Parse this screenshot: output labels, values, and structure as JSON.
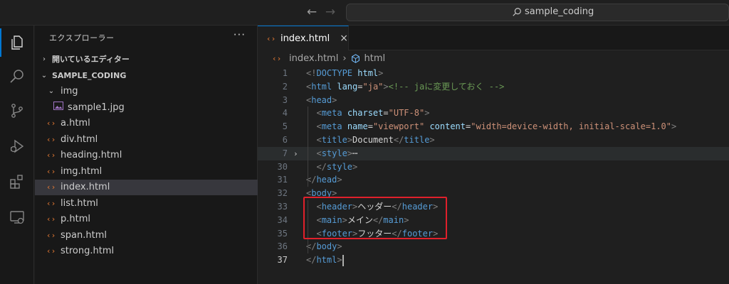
{
  "titlebar": {
    "search_text": "sample_coding",
    "back_icon": "arrow-left-icon",
    "forward_icon": "arrow-right-icon"
  },
  "activity_bar": [
    "explorer-icon",
    "search-icon",
    "source-control-icon",
    "run-debug-icon",
    "extensions-icon",
    "remote-explorer-icon"
  ],
  "sidebar": {
    "title": "エクスプローラー",
    "more": "···",
    "open_editors": "開いているエディター",
    "project": "SAMPLE_CODING",
    "folder": "img",
    "items": [
      {
        "label": "sample1.jpg",
        "type": "image"
      },
      {
        "label": "a.html",
        "type": "html"
      },
      {
        "label": "div.html",
        "type": "html"
      },
      {
        "label": "heading.html",
        "type": "html"
      },
      {
        "label": "img.html",
        "type": "html"
      },
      {
        "label": "index.html",
        "type": "html",
        "selected": true
      },
      {
        "label": "list.html",
        "type": "html"
      },
      {
        "label": "p.html",
        "type": "html"
      },
      {
        "label": "span.html",
        "type": "html"
      },
      {
        "label": "strong.html",
        "type": "html"
      }
    ]
  },
  "editor": {
    "tab_label": "index.html",
    "tab_close": "×",
    "tab_icon": "‹›",
    "breadcrumb": {
      "file": "index.html",
      "sep": "›",
      "node": "html"
    },
    "lines": [
      {
        "n": "1",
        "segments": [
          [
            "br",
            "<!"
          ],
          [
            "tag",
            "DOCTYPE "
          ],
          [
            "attr",
            "html"
          ],
          [
            "br",
            ">"
          ]
        ]
      },
      {
        "n": "2",
        "segments": [
          [
            "br",
            "<"
          ],
          [
            "tag",
            "html "
          ],
          [
            "attr",
            "lang"
          ],
          [
            "txt",
            "="
          ],
          [
            "str",
            "\"ja\""
          ],
          [
            "br",
            ">"
          ],
          [
            "com",
            "<!-- jaに変更しておく -->"
          ]
        ]
      },
      {
        "n": "3",
        "segments": [
          [
            "br",
            "<"
          ],
          [
            "tag",
            "head"
          ],
          [
            "br",
            ">"
          ]
        ]
      },
      {
        "n": "4",
        "segments": [
          [
            "txt",
            "  "
          ],
          [
            "br",
            "<"
          ],
          [
            "tag",
            "meta "
          ],
          [
            "attr",
            "charset"
          ],
          [
            "txt",
            "="
          ],
          [
            "str",
            "\"UTF-8\""
          ],
          [
            "br",
            ">"
          ]
        ]
      },
      {
        "n": "5",
        "segments": [
          [
            "txt",
            "  "
          ],
          [
            "br",
            "<"
          ],
          [
            "tag",
            "meta "
          ],
          [
            "attr",
            "name"
          ],
          [
            "txt",
            "="
          ],
          [
            "str",
            "\"viewport\" "
          ],
          [
            "attr",
            "content"
          ],
          [
            "txt",
            "="
          ],
          [
            "str",
            "\"width=device-width, initial-scale=1.0\""
          ],
          [
            "br",
            ">"
          ]
        ]
      },
      {
        "n": "6",
        "segments": [
          [
            "txt",
            "  "
          ],
          [
            "br",
            "<"
          ],
          [
            "tag",
            "title"
          ],
          [
            "br",
            ">"
          ],
          [
            "txt",
            "Document"
          ],
          [
            "br",
            "</"
          ],
          [
            "tag",
            "title"
          ],
          [
            "br",
            ">"
          ]
        ]
      },
      {
        "n": "7",
        "segments": [
          [
            "txt",
            "  "
          ],
          [
            "br",
            "<"
          ],
          [
            "tag",
            "style"
          ],
          [
            "br",
            ">"
          ],
          [
            "txt",
            "⋯"
          ]
        ]
      },
      {
        "n": "30",
        "segments": [
          [
            "txt",
            "  "
          ],
          [
            "br",
            "</"
          ],
          [
            "tag",
            "style"
          ],
          [
            "br",
            ">"
          ]
        ]
      },
      {
        "n": "31",
        "segments": [
          [
            "br",
            "</"
          ],
          [
            "tag",
            "head"
          ],
          [
            "br",
            ">"
          ]
        ]
      },
      {
        "n": "32",
        "segments": [
          [
            "br",
            "<"
          ],
          [
            "tag",
            "body"
          ],
          [
            "br",
            ">"
          ]
        ]
      },
      {
        "n": "33",
        "segments": [
          [
            "txt",
            "  "
          ],
          [
            "br",
            "<"
          ],
          [
            "tag",
            "header"
          ],
          [
            "br",
            ">"
          ],
          [
            "txt",
            "ヘッダー"
          ],
          [
            "br",
            "</"
          ],
          [
            "tag",
            "header"
          ],
          [
            "br",
            ">"
          ]
        ]
      },
      {
        "n": "34",
        "segments": [
          [
            "txt",
            "  "
          ],
          [
            "br",
            "<"
          ],
          [
            "tag",
            "main"
          ],
          [
            "br",
            ">"
          ],
          [
            "txt",
            "メイン"
          ],
          [
            "br",
            "</"
          ],
          [
            "tag",
            "main"
          ],
          [
            "br",
            ">"
          ]
        ]
      },
      {
        "n": "35",
        "segments": [
          [
            "txt",
            "  "
          ],
          [
            "br",
            "<"
          ],
          [
            "tag",
            "footer"
          ],
          [
            "br",
            ">"
          ],
          [
            "txt",
            "フッター"
          ],
          [
            "br",
            "</"
          ],
          [
            "tag",
            "footer"
          ],
          [
            "br",
            ">"
          ]
        ]
      },
      {
        "n": "36",
        "segments": [
          [
            "br",
            "</"
          ],
          [
            "tag",
            "body"
          ],
          [
            "br",
            ">"
          ]
        ]
      },
      {
        "n": "37",
        "segments": [
          [
            "br",
            "</"
          ],
          [
            "tag",
            "html"
          ],
          [
            "br",
            ">"
          ]
        ]
      }
    ]
  },
  "colors": {
    "accent": "#0078d4",
    "highlight_box": "#e0202b",
    "html_icon": "#e37933"
  }
}
